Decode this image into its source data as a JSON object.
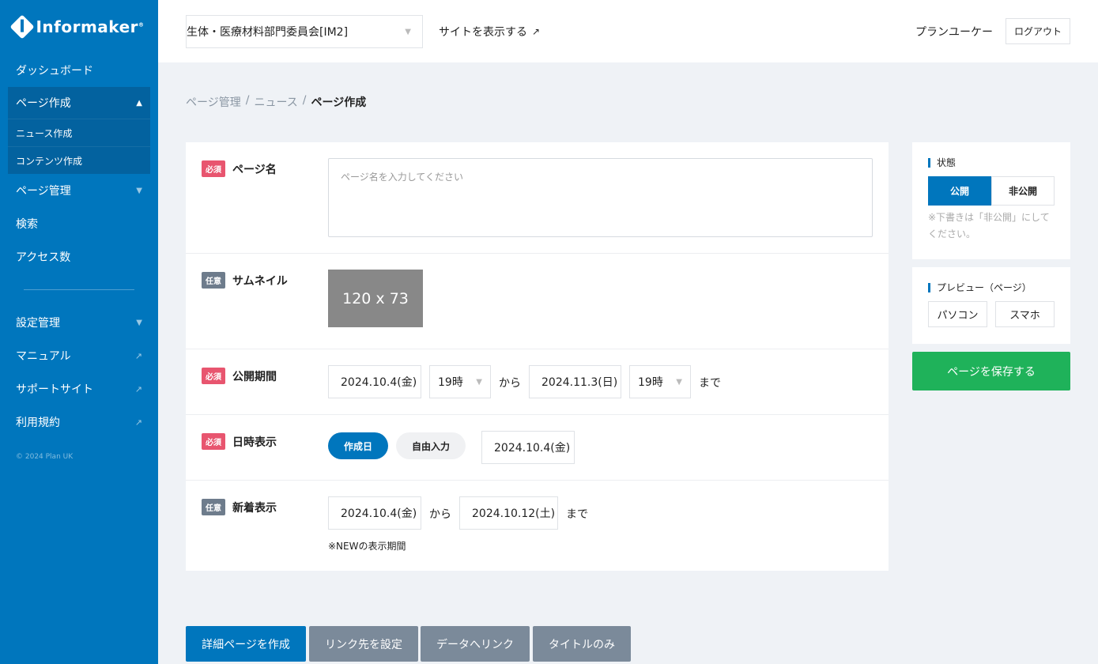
{
  "brand": {
    "name": "Informaker",
    "mark": "®"
  },
  "sidebar": {
    "items": [
      {
        "label": "ダッシュボード"
      },
      {
        "label": "ページ作成",
        "expanded": true,
        "children": [
          {
            "label": "ニュース作成"
          },
          {
            "label": "コンテンツ作成"
          }
        ]
      },
      {
        "label": "ページ管理"
      },
      {
        "label": "検索"
      },
      {
        "label": "アクセス数"
      },
      {
        "label": "設定管理"
      },
      {
        "label": "マニュアル",
        "icon": "external-link-icon"
      },
      {
        "label": "サポートサイト",
        "icon": "external-link-icon"
      },
      {
        "label": "利用規約",
        "icon": "external-link-icon"
      }
    ],
    "copyright": "© 2024 Plan UK"
  },
  "header": {
    "site_select": "生体・医療材料部門委員会[IM2]",
    "view_site": "サイトを表示する",
    "user_name": "プランユーケー",
    "logout": "ログアウト"
  },
  "breadcrumb": {
    "items": [
      "ページ管理",
      "ニュース"
    ],
    "separator": "/",
    "current": "ページ作成"
  },
  "form": {
    "required_badge": "必須",
    "optional_badge": "任意",
    "page_name": {
      "label": "ページ名",
      "placeholder": "ページ名を入力してください"
    },
    "thumbnail": {
      "label": "サムネイル",
      "placeholder_text": "120 x 73"
    },
    "period": {
      "label": "公開期間",
      "start_date": "2024.10.4(金)",
      "start_hour": "19時",
      "from": "から",
      "end_date": "2024.11.3(日)",
      "end_hour": "19時",
      "until": "まで"
    },
    "datetime_display": {
      "label": "日時表示",
      "option_created": "作成日",
      "option_free": "自由入力",
      "date": "2024.10.4(金)"
    },
    "new_display": {
      "label": "新着表示",
      "start_date": "2024.10.4(金)",
      "from": "から",
      "end_date": "2024.10.12(土)",
      "until": "まで",
      "note": "※NEWの表示期間"
    }
  },
  "status_panel": {
    "title": "状態",
    "public": "公開",
    "private": "非公開",
    "hint": "※下書きは「非公開」にしてください。"
  },
  "preview_panel": {
    "title": "プレビュー（ページ）",
    "pc": "パソコン",
    "phone": "スマホ"
  },
  "save_button": "ページを保存する",
  "bottom_buttons": {
    "detail": "詳細ページを作成",
    "link": "リンク先を設定",
    "data": "データへリンク",
    "title_only": "タイトルのみ"
  },
  "colors": {
    "primary": "#0076bd",
    "save": "#1fb25a",
    "required": "#e8556f",
    "optional": "#6e7c8c"
  }
}
